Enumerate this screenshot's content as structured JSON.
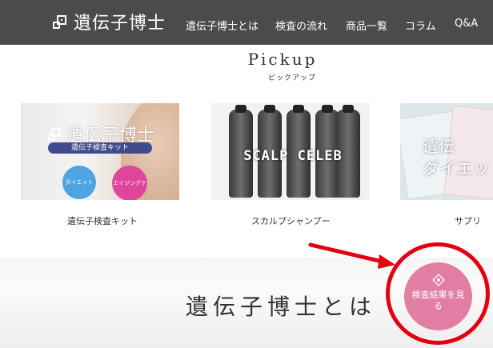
{
  "header": {
    "logo_text": "遺伝子博士",
    "nav": [
      "遺伝子博士とは",
      "検査の流れ",
      "商品一覧",
      "コラム",
      "Q&A"
    ]
  },
  "pickup": {
    "title": "Pickup",
    "subtitle": "ピックアップ"
  },
  "cards": [
    {
      "label": "遺伝子検査キット",
      "brand": "遺伝子博士",
      "band_text": "遺伝子検査キット",
      "badges": [
        "ダイエット",
        "エイジングケア"
      ]
    },
    {
      "label": "スカルプシャンプー",
      "logo_text": "SCALP CELEB"
    },
    {
      "label": "サプリ",
      "overlay_line1": "遺伝",
      "overlay_line2": "ダイエッ"
    }
  ],
  "about": {
    "title": "遺伝子博士とは"
  },
  "result_button": {
    "label": "検査結果を見る"
  },
  "colors": {
    "header_bg": "#4b4b4b",
    "button_pink": "#e27ea3",
    "highlight_red": "#e30010"
  }
}
